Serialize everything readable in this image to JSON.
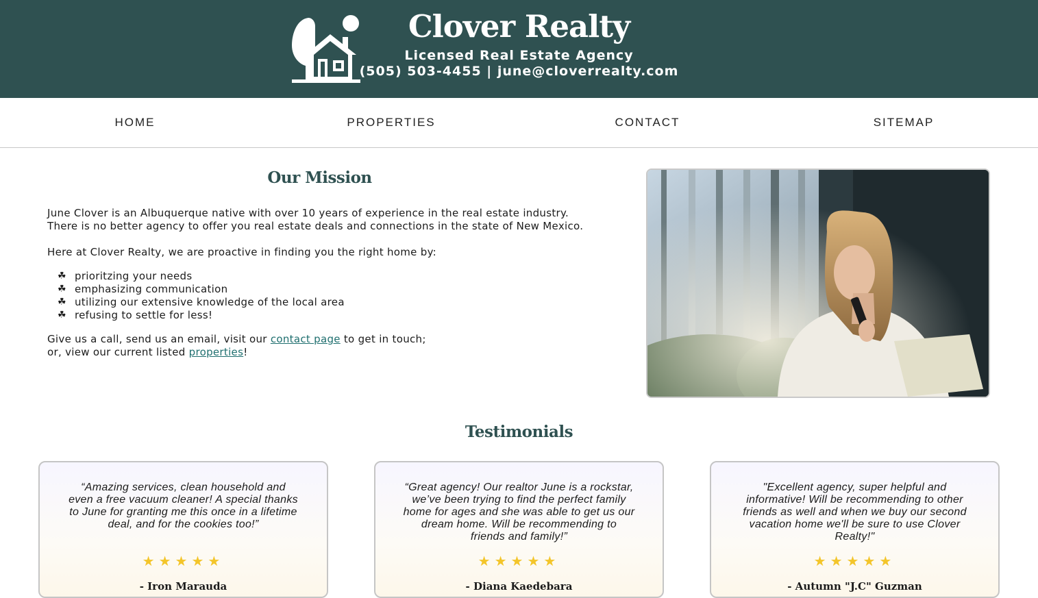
{
  "header": {
    "title": "Clover Realty",
    "subtitle": "Licensed Real Estate Agency",
    "contact": "(505) 503-4455 | june@cloverrealty.com",
    "background_color": "#2f5151",
    "logo_icon": "house-tree-sun-icon"
  },
  "nav": {
    "items": [
      {
        "label": "HOME"
      },
      {
        "label": "PROPERTIES"
      },
      {
        "label": "CONTACT"
      },
      {
        "label": "SITEMAP"
      }
    ]
  },
  "mission": {
    "title": "Our Mission",
    "para1_line1": "June Clover is an Albuquerque native with over 10 years of experience in the real estate industry.",
    "para1_line2": "There is no better agency to offer you real estate deals and connections in the state of New Mexico.",
    "para2": "Here at Clover Realty, we are proactive in finding you the right home by:",
    "bullet_glyph": "☘",
    "list": [
      "prioritzing your needs",
      "emphasizing communication",
      "utilizing our extensive knowledge of the local area",
      "refusing to settle for less!"
    ],
    "cta_pre": "Give us a call, send us an email, visit our ",
    "cta_link1": "contact page",
    "cta_mid": " to get in touch;",
    "cta_line2_pre": "or, view our current listed ",
    "cta_link2": "properties",
    "cta_end": "!",
    "link_color": "#1f6f6f"
  },
  "photo": {
    "icon": "woman-with-phone-photo"
  },
  "testimonials": {
    "title": "Testimonials",
    "stars": "★★★★★",
    "star_color": "#f3c52a",
    "cards": [
      {
        "quote": "“Amazing services, clean household and even a free vacuum cleaner! A special thanks to June for granting me this once in a lifetime deal, and for the cookies too!”",
        "rating": 5,
        "author": "- Iron Marauda"
      },
      {
        "quote": "“Great agency! Our realtor June is a rockstar, we’ve been trying to find the perfect family home for ages and she was able to get us our dream home. Will be recommending to friends and family!”",
        "rating": 5,
        "author": "- Diana Kaedebara"
      },
      {
        "quote": "\"Excellent agency, super helpful and informative! Will be recommending to other friends as well and when we buy our second vacation home we'll be sure to use Clover Realty!\"",
        "rating": 5,
        "author": "- Autumn \"J.C\" Guzman"
      }
    ]
  }
}
